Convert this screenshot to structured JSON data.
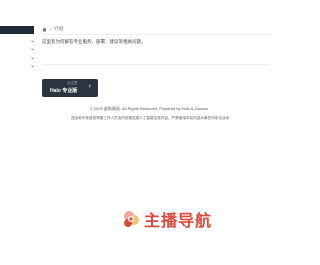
{
  "breadcrumb": {
    "current": "介绍"
  },
  "notice": "这里有为何解答专业服务、部署、建议等相关问题。",
  "promo": {
    "sub": "点这里",
    "label": "Halo 专业版"
  },
  "footer": {
    "copyright": "© 2025 虚拟驿站. All Rights Reserved. Powered by Halo & Dococo",
    "disclaimer": "违法和不良信息举报工作人员及时处理这类人工智能生成内容，严禁使用本站内容从事任何非法活动"
  },
  "logo": {
    "text": "主播导航"
  },
  "colors": {
    "brand": "#e0483b",
    "sidebar": "#1f2a36",
    "promo_bg": "#2b3440"
  }
}
